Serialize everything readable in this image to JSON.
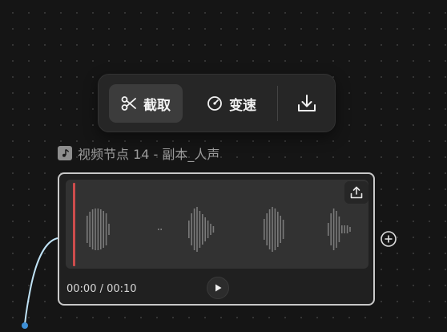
{
  "toolbar": {
    "clip_label": "截取",
    "speed_label": "变速"
  },
  "node": {
    "title": "视频节点 14 - 副本_人声",
    "time": "00:00 / 00:10",
    "waveform_heights": [
      [
        34,
        44,
        50,
        52,
        52,
        50,
        46,
        40,
        14
      ],
      [
        2,
        2
      ],
      [
        22,
        40,
        52,
        56,
        46,
        38,
        30,
        22,
        14,
        8
      ],
      [
        26,
        40,
        50,
        56,
        52,
        44,
        34,
        24
      ],
      [
        16,
        40,
        52,
        46,
        32,
        10,
        10,
        10,
        6
      ]
    ]
  },
  "colors": {
    "background": "#151515",
    "card_border": "#c9c9c9",
    "playhead": "#cc4c4c",
    "edge": "#bfe2f5",
    "edge_dot": "#3d8fd6"
  }
}
